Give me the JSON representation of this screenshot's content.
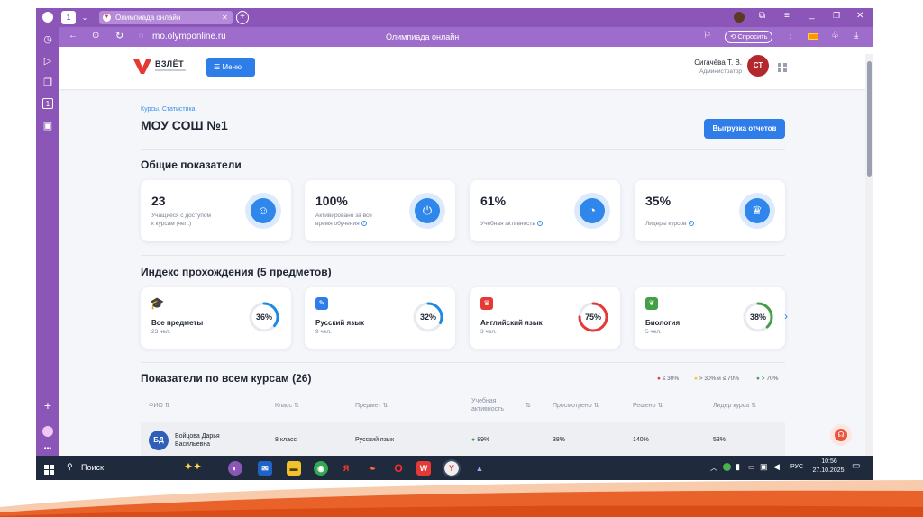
{
  "browser": {
    "tab_title": "Олимпиада онлайн",
    "tab_count": "1",
    "url": "mo.olymponline.ru",
    "page_title": "Олимпиада онлайн",
    "ask_label": "Спросить"
  },
  "header": {
    "logo_text": "ВЗЛЁТ",
    "menu_label": "Меню",
    "user_name": "Сигачёва Т. В.",
    "user_role": "Администратор",
    "avatar_initials": "СТ"
  },
  "page": {
    "breadcrumb": "Курсы. Статистика",
    "title": "МОУ СОШ №1",
    "export_button": "Выгрузка отчетов"
  },
  "general": {
    "title": "Общие показатели",
    "cards": [
      {
        "value": "23",
        "label_line1": "Учащиеся с доступом",
        "label_line2": "к курсам (чел.)",
        "icon": "student-icon"
      },
      {
        "value": "100%",
        "label_line1": "Активировано за всё",
        "label_line2": "время обучения",
        "icon": "power-icon"
      },
      {
        "value": "61%",
        "label_line1": "Учебная активность",
        "label_line2": "",
        "icon": "pie-chart-icon"
      },
      {
        "value": "35%",
        "label_line1": "Лидеры курсов",
        "label_line2": "",
        "icon": "crown-icon"
      }
    ]
  },
  "index": {
    "title": "Индекс прохождения (5 предметов)",
    "subjects": [
      {
        "name": "Все предметы",
        "count": "23 чел.",
        "percent_label": "36%",
        "percent": 36,
        "color": "#1e88e5",
        "icon": "graduation-cap-icon"
      },
      {
        "name": "Русский язык",
        "count": "9 чел.",
        "percent_label": "32%",
        "percent": 32,
        "color": "#1e88e5",
        "icon": "pencil-icon"
      },
      {
        "name": "Английский язык",
        "count": "3 чел.",
        "percent_label": "75%",
        "percent": 75,
        "color": "#e53935",
        "icon": "crown-small-icon"
      },
      {
        "name": "Биология",
        "count": "5 чел.",
        "percent_label": "38%",
        "percent": 38,
        "color": "#43a047",
        "icon": "leaf-icon"
      }
    ]
  },
  "courses": {
    "title": "Показатели по всем курсам (26)",
    "legend": [
      {
        "label": "≤ 30%",
        "color": "#e53935"
      },
      {
        "label": "> 30% и ≤ 70%",
        "color": "#fbc02d"
      },
      {
        "label": "> 70%",
        "color": "#43a047"
      }
    ],
    "columns": [
      "ФИО",
      "Класс",
      "Предмет",
      "Учебная активность",
      "Просмотрено",
      "Решено",
      "Лидер курса"
    ],
    "rows": [
      {
        "initials": "БД",
        "name_line1": "Бойцова Дарья",
        "name_line2": "Васильевна",
        "class": "8 класс",
        "subject": "Русский язык",
        "activity": "89%",
        "viewed": "38%",
        "solved": "140%",
        "leader": "53%"
      }
    ]
  },
  "taskbar": {
    "search_label": "Поиск",
    "lang": "РУС",
    "time": "10:56",
    "date": "27.10.2025"
  }
}
